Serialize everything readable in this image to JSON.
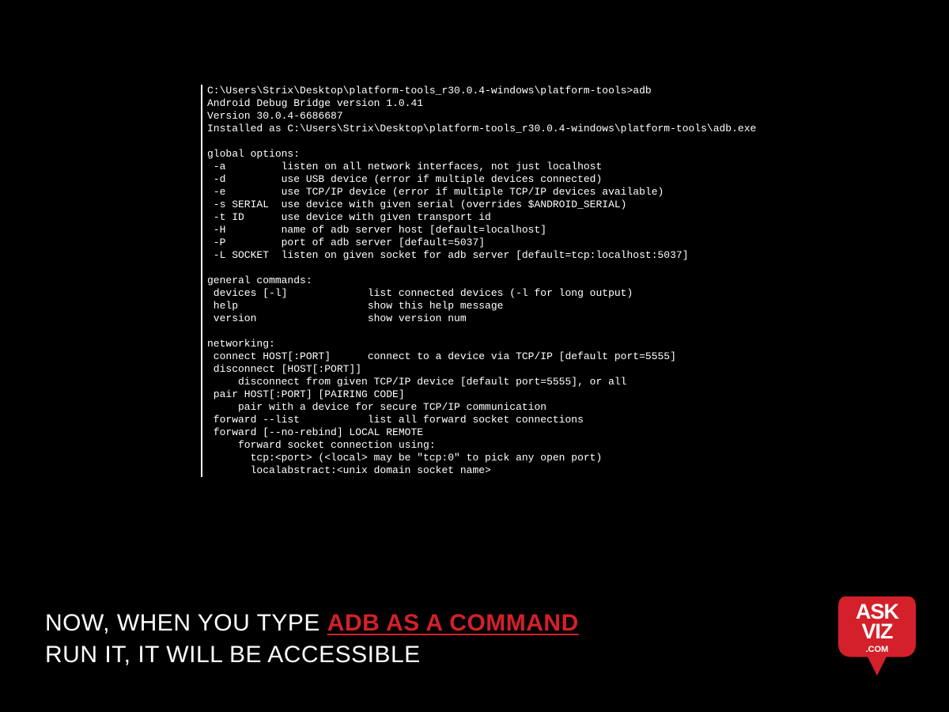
{
  "terminal": {
    "prompt": "C:\\Users\\Strix\\Desktop\\platform-tools_r30.0.4-windows\\platform-tools>adb",
    "header": [
      "Android Debug Bridge version 1.0.41",
      "Version 30.0.4-6686687",
      "Installed as C:\\Users\\Strix\\Desktop\\platform-tools_r30.0.4-windows\\platform-tools\\adb.exe"
    ],
    "sections": [
      {
        "title": "global options:",
        "lines": [
          " -a         listen on all network interfaces, not just localhost",
          " -d         use USB device (error if multiple devices connected)",
          " -e         use TCP/IP device (error if multiple TCP/IP devices available)",
          " -s SERIAL  use device with given serial (overrides $ANDROID_SERIAL)",
          " -t ID      use device with given transport id",
          " -H         name of adb server host [default=localhost]",
          " -P         port of adb server [default=5037]",
          " -L SOCKET  listen on given socket for adb server [default=tcp:localhost:5037]"
        ]
      },
      {
        "title": "general commands:",
        "lines": [
          " devices [-l]             list connected devices (-l for long output)",
          " help                     show this help message",
          " version                  show version num"
        ]
      },
      {
        "title": "networking:",
        "lines": [
          " connect HOST[:PORT]      connect to a device via TCP/IP [default port=5555]",
          " disconnect [HOST[:PORT]]",
          "     disconnect from given TCP/IP device [default port=5555], or all",
          " pair HOST[:PORT] [PAIRING CODE]",
          "     pair with a device for secure TCP/IP communication",
          " forward --list           list all forward socket connections",
          " forward [--no-rebind] LOCAL REMOTE",
          "     forward socket connection using:",
          "       tcp:<port> (<local> may be \"tcp:0\" to pick any open port)",
          "       localabstract:<unix domain socket name>"
        ]
      }
    ]
  },
  "caption": {
    "part1": "NOW, WHEN YOU TYPE ",
    "highlight": "ADB AS A COMMAND",
    "part2": "RUN IT, IT WILL BE ACCESSIBLE"
  },
  "logo": {
    "line1": "ASK",
    "line2": "VIZ",
    "dotcom": ".COM",
    "color": "#d4202a"
  }
}
